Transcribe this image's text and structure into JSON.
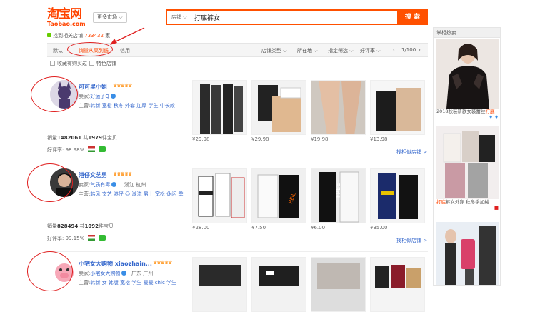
{
  "header": {
    "logo_cn": "淘宝网",
    "logo_en": "Taobao.com",
    "market_label": "更多市场 ⌵",
    "search_type": "店铺 ⌵",
    "search_query": "打底裤女",
    "search_button": "搜 索"
  },
  "found": {
    "prefix": "找到相关店铺",
    "count": "733432",
    "suffix": "家"
  },
  "sort": {
    "default": "默认",
    "sales": "销量从高到低",
    "credit": "信用",
    "shop_type": "店铺类型",
    "location": "所在地",
    "designated": "指定筛选",
    "rating": "好评率",
    "page": "1/100"
  },
  "checks": {
    "consumer_protect": "收藏有购买过",
    "special": "特色店铺"
  },
  "sidebar": {
    "title": "掌柜热卖",
    "items": [
      {
        "title": "2018秋装新款女装蕾丝",
        "hl": "打底",
        "extra": ""
      },
      {
        "title": "",
        "hl": "打底",
        "extra": "裤女外穿 秋冬季加绒"
      },
      {
        "title": "",
        "hl": "",
        "extra": ""
      }
    ]
  },
  "shops": [
    {
      "name": "可可里小姐",
      "crowns": "♛♛♛♛♛",
      "seller_label": "卖家:",
      "seller": "好运子Q",
      "location": "",
      "main_label": "主营:",
      "main": "韩新 宽松 秋冬 外套 加厚 学生 中长款",
      "sales_label": "销量",
      "sales": "1482061",
      "items_prefix": "共",
      "items": "1979",
      "items_suffix": "件宝贝",
      "rate_label": "好评率:",
      "rate": "98.98%",
      "prices": [
        "¥29.98",
        "¥29.98",
        "¥19.98",
        "¥13.98"
      ],
      "more": "找相似店铺 >"
    },
    {
      "name": "港仔文艺男",
      "crowns": "♛♛♛♛♛",
      "seller_label": "卖家:",
      "seller": "气质有毒",
      "location": "浙江 杭州",
      "main_label": "主营:",
      "main": "韩风 文艺 港仔 ☺ 潮流 男士 宽松 休闲 季",
      "sales_label": "销量",
      "sales": "828494",
      "items_prefix": "共",
      "items": "1092",
      "items_suffix": "件宝贝",
      "rate_label": "好评率:",
      "rate": "99.15%",
      "prices": [
        "¥28.00",
        "¥7.50",
        "¥6.00",
        "¥35.00"
      ],
      "more": "找相似店铺 >"
    },
    {
      "name": "小宅女大购物 xiaozhain...",
      "crowns": "♛♛♛♛♛",
      "seller_label": "卖家:",
      "seller": "小宅女大购物",
      "location": "广东 广州",
      "main_label": "主营:",
      "main": "韩新 女 韩版 宽松 学生 暖暖 chic 学生",
      "sales_label": "",
      "sales": "",
      "items_prefix": "",
      "items": "",
      "items_suffix": "",
      "rate_label": "",
      "rate": "",
      "prices": [
        "",
        "",
        "",
        ""
      ],
      "more": ""
    }
  ],
  "colors": {
    "accent": "#ff5000",
    "link": "#3366cc",
    "annotation": "#e02020"
  }
}
